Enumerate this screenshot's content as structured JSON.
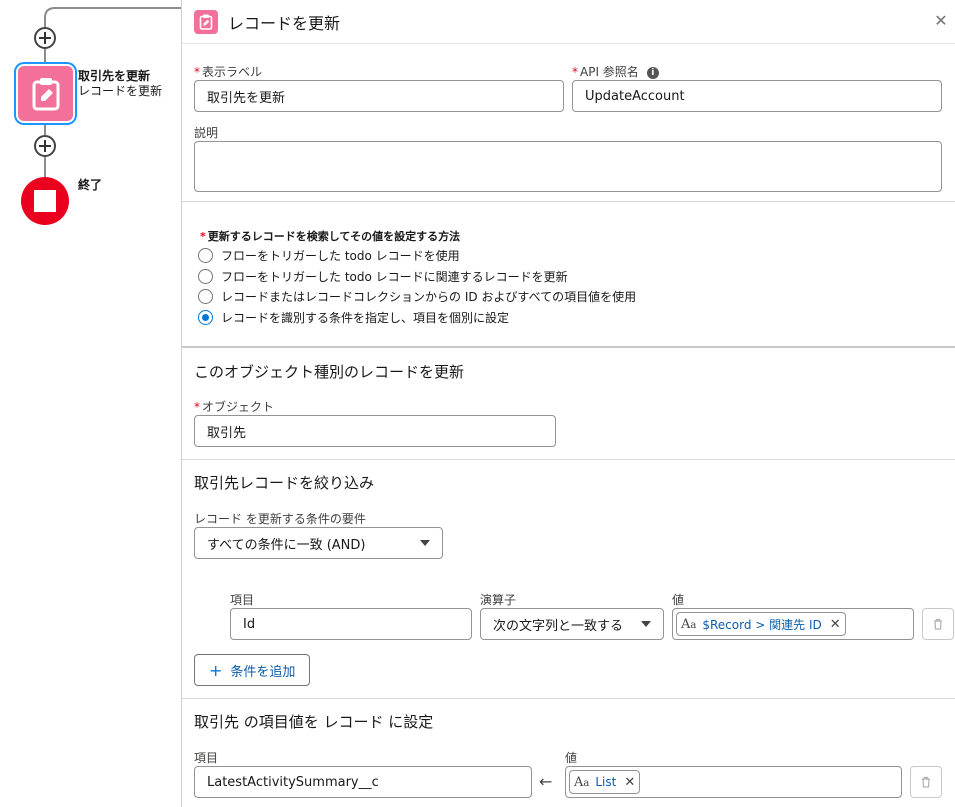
{
  "canvas": {
    "element_node": {
      "title": "取引先を更新",
      "subtitle": "レコードを更新"
    },
    "end_node": {
      "title": "終了"
    }
  },
  "panel": {
    "title": "レコードを更新",
    "label_field": {
      "label": "表示ラベル",
      "value": "取引先を更新"
    },
    "api_field": {
      "label": "API 参照名",
      "value": "UpdateAccount"
    },
    "description": {
      "label": "説明",
      "value": ""
    },
    "method": {
      "label": "更新するレコードを検索してその値を設定する方法",
      "options": [
        "フローをトリガーした todo レコードを使用",
        "フローをトリガーした todo レコードに関連するレコードを更新",
        "レコードまたはレコードコレクションからの ID およびすべての項目値を使用",
        "レコードを識別する条件を指定し、項目を個別に設定"
      ],
      "selected_index": 3
    },
    "object_section": {
      "title": "このオブジェクト種別のレコードを更新",
      "object_label": "オブジェクト",
      "object_value": "取引先"
    },
    "filter_section": {
      "title": "取引先レコードを絞り込み",
      "requirement_label": "レコード を更新する条件の要件",
      "requirement_value": "すべての条件に一致 (AND)",
      "field_header": "項目",
      "operator_header": "演算子",
      "value_header": "値",
      "row": {
        "field": "Id",
        "operator": "次の文字列と一致する",
        "value": "$Record > 関連先 ID"
      },
      "add_condition": "条件を追加"
    },
    "set_section": {
      "title": "取引先 の項目値を レコード に設定",
      "field_header": "項目",
      "value_header": "値",
      "row": {
        "field": "LatestActivitySummary__c",
        "arrow": "←",
        "value": "List"
      }
    }
  },
  "colors": {
    "element_pink": "#f2709a",
    "end_red": "#ea001e",
    "link_blue": "#0b5cab",
    "brand_blue": "#0176d3"
  }
}
